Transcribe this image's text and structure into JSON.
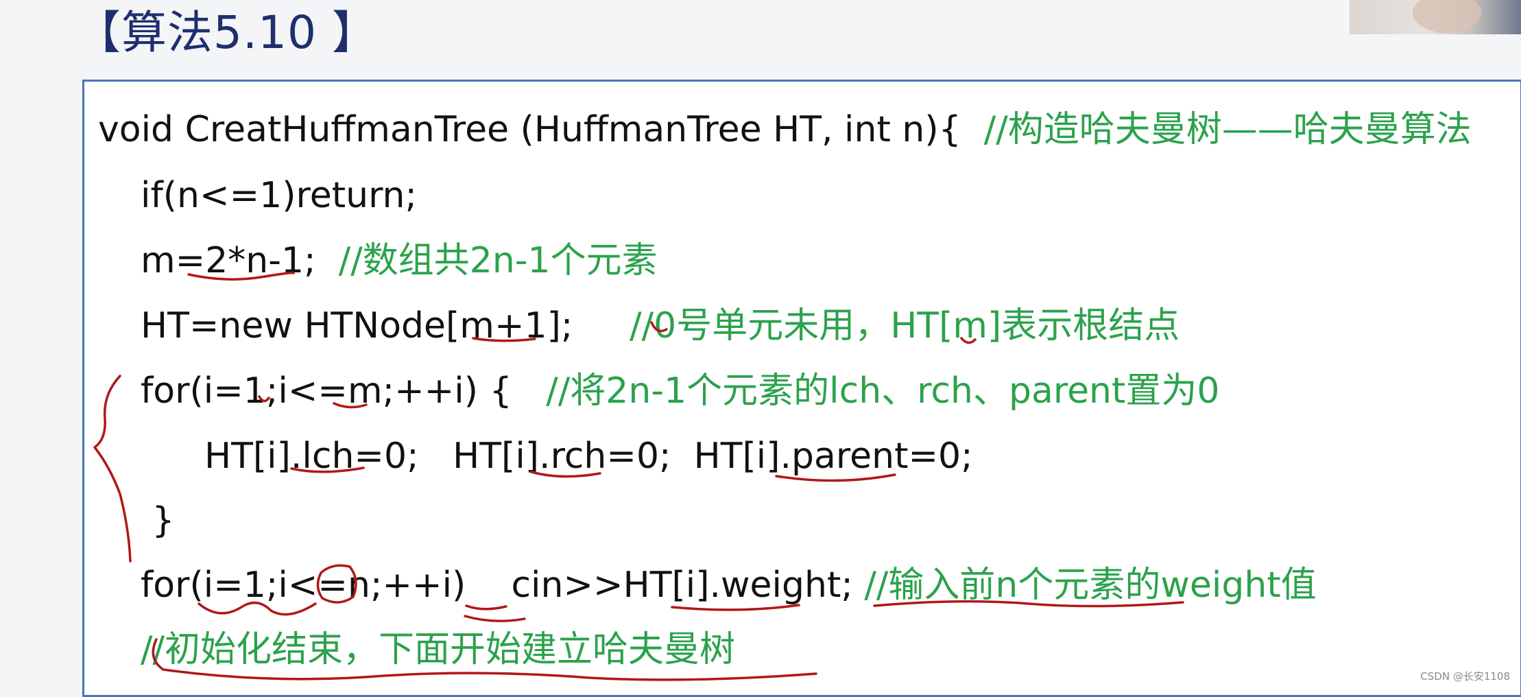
{
  "heading": "【算法5.10 】",
  "code": [
    {
      "code": "void CreatHuffmanTree (HuffmanTree HT, int n){  ",
      "comment": "//构造哈夫曼树——哈夫曼算法"
    },
    {
      "code": "if(n<=1)return;",
      "comment": ""
    },
    {
      "code": "m=2*n-1;  ",
      "comment": "//数组共2n-1个元素"
    },
    {
      "code": "HT=new HTNode[m+1];     ",
      "comment": "//0号单元未用，HT[m]表示根结点"
    },
    {
      "code": "for(i=1;i<=m;++i) {   ",
      "comment": "//将2n-1个元素的lch、rch、parent置为0"
    },
    {
      "code": "HT[i].lch=0;   HT[i].rch=0;  HT[i].parent=0;",
      "comment": ""
    },
    {
      "code": " }",
      "comment": ""
    },
    {
      "code": "for(i=1;i<=n;++i)    cin>>HT[i].weight; ",
      "comment": "//输入前n个元素的weight值"
    },
    {
      "code": "",
      "comment": "//初始化结束，下面开始建立哈夫曼树"
    }
  ],
  "watermark": "CSDN @长安1108",
  "colors": {
    "heading": "#1e2f6e",
    "code_text": "#111111",
    "comment": "#2ba24c",
    "box_border": "#4a74b8",
    "ink": "#b01818"
  }
}
